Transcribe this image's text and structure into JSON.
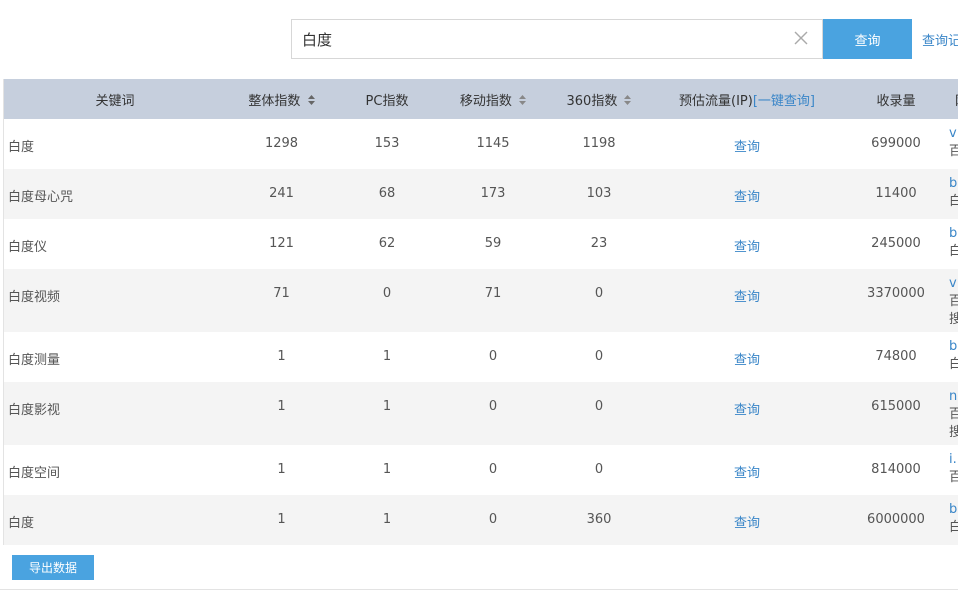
{
  "search": {
    "value": "白度",
    "button_label": "查询",
    "history_label": "查询记"
  },
  "table": {
    "headers": {
      "keyword": "关键词",
      "overall": "整体指数",
      "pc": "PC指数",
      "mobile": "移动指数",
      "index360": "360指数",
      "traffic": "预估流量(IP)",
      "traffic_bulk": "[一键查询]",
      "indexed": "收录量",
      "site": "网"
    },
    "rows": [
      {
        "keyword": "白度",
        "overall": "1298",
        "pc": "153",
        "mobile": "1145",
        "index360": "1198",
        "traffic": "查询",
        "indexed": "699000",
        "site": [
          "v",
          "百"
        ]
      },
      {
        "keyword": "白度母心咒",
        "overall": "241",
        "pc": "68",
        "mobile": "173",
        "index360": "103",
        "traffic": "查询",
        "indexed": "11400",
        "site": [
          "b",
          "白"
        ]
      },
      {
        "keyword": "白度仪",
        "overall": "121",
        "pc": "62",
        "mobile": "59",
        "index360": "23",
        "traffic": "查询",
        "indexed": "245000",
        "site": [
          "b",
          "白"
        ]
      },
      {
        "keyword": "白度视频",
        "overall": "71",
        "pc": "0",
        "mobile": "71",
        "index360": "0",
        "traffic": "查询",
        "indexed": "3370000",
        "site": [
          "v",
          "百",
          "搜"
        ]
      },
      {
        "keyword": "白度测量",
        "overall": "1",
        "pc": "1",
        "mobile": "0",
        "index360": "0",
        "traffic": "查询",
        "indexed": "74800",
        "site": [
          "b",
          "白"
        ]
      },
      {
        "keyword": "白度影视",
        "overall": "1",
        "pc": "1",
        "mobile": "0",
        "index360": "0",
        "traffic": "查询",
        "indexed": "615000",
        "site": [
          "n",
          "百",
          "搜"
        ]
      },
      {
        "keyword": "白度空间",
        "overall": "1",
        "pc": "1",
        "mobile": "0",
        "index360": "0",
        "traffic": "查询",
        "indexed": "814000",
        "site": [
          "i.",
          "百"
        ]
      },
      {
        "keyword": "白度",
        "overall": "1",
        "pc": "1",
        "mobile": "0",
        "index360": "360",
        "traffic": "查询",
        "indexed": "6000000",
        "site": [
          "b",
          "白"
        ]
      }
    ]
  },
  "export_label": "导出数据",
  "colors": {
    "accent": "#4aa3e0",
    "link": "#3a86c8",
    "header_bg": "#c6cfdd",
    "stripe_bg": "#f4f4f4"
  },
  "icons": {
    "clear": "close-icon",
    "sort": "sort-icon"
  }
}
